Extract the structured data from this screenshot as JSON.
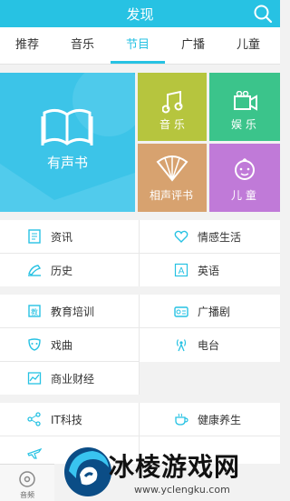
{
  "header": {
    "title": "发现"
  },
  "tabs": [
    {
      "label": "推荐"
    },
    {
      "label": "音乐"
    },
    {
      "label": "节目",
      "active": true
    },
    {
      "label": "广播"
    },
    {
      "label": "儿童"
    }
  ],
  "tiles": {
    "big": "有声书",
    "music": "音 乐",
    "ent": "娱 乐",
    "xiangsheng": "相声评书",
    "kids": "儿 童"
  },
  "categories": {
    "group1": [
      {
        "label": "资讯",
        "icon": "news-icon"
      },
      {
        "label": "情感生活",
        "icon": "heart-icon"
      },
      {
        "label": "历史",
        "icon": "history-icon"
      },
      {
        "label": "英语",
        "icon": "english-icon"
      }
    ],
    "group2": [
      {
        "label": "教育培训",
        "icon": "education-icon"
      },
      {
        "label": "广播剧",
        "icon": "radio-drama-icon"
      },
      {
        "label": "戏曲",
        "icon": "opera-mask-icon"
      },
      {
        "label": "电台",
        "icon": "antenna-icon"
      },
      {
        "label": "商业财经",
        "icon": "chart-icon"
      }
    ],
    "group3": [
      {
        "label": "IT科技",
        "icon": "network-icon"
      },
      {
        "label": "健康养生",
        "icon": "cup-icon"
      }
    ]
  },
  "bottom_nav": {
    "label": "音频"
  },
  "watermark": {
    "text": "冰棱游戏网",
    "url": "www.yclengku.com"
  },
  "colors": {
    "accent": "#27c2e3",
    "icon": "#27c2e3"
  }
}
